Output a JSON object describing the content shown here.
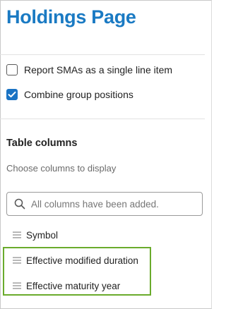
{
  "page": {
    "title": "Holdings Page"
  },
  "options": [
    {
      "label": "Report SMAs as a single line item",
      "checked": false
    },
    {
      "label": "Combine group positions",
      "checked": true
    }
  ],
  "table_columns": {
    "title": "Table columns",
    "subtitle": "Choose columns to display",
    "search_placeholder": "All columns have been added.",
    "items": [
      {
        "label": "Symbol"
      },
      {
        "label": "Effective modified duration"
      },
      {
        "label": "Effective maturity year"
      }
    ]
  },
  "colors": {
    "title": "#1a7ac3",
    "checkbox_checked": "#1a73c4",
    "highlight": "#6aab2c"
  },
  "icons": [
    "check-icon",
    "search-icon",
    "drag-handle-icon"
  ]
}
